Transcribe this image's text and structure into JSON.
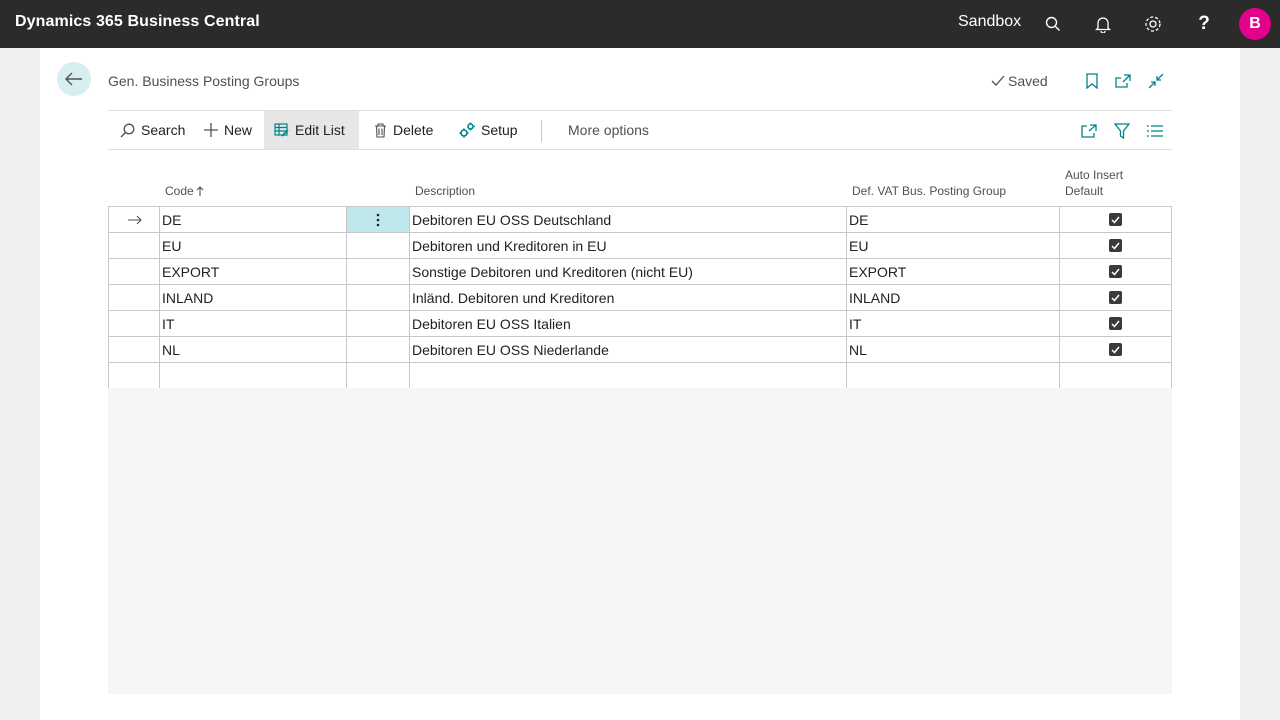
{
  "app": {
    "title": "Dynamics 365 Business Central",
    "environment": "Sandbox",
    "user_initial": "B"
  },
  "page": {
    "title": "Gen. Business Posting Groups",
    "status": "Saved"
  },
  "actions": {
    "search": "Search",
    "new": "New",
    "edit_list": "Edit List",
    "delete": "Delete",
    "setup": "Setup",
    "more_options": "More options"
  },
  "columns": {
    "code": "Code",
    "description": "Description",
    "def_vat": "Def. VAT Bus. Posting Group",
    "auto_insert": "Auto Insert Default"
  },
  "rows": [
    {
      "code": "DE",
      "description": "Debitoren EU OSS Deutschland",
      "def_vat": "DE",
      "auto_insert": true
    },
    {
      "code": "EU",
      "description": "Debitoren und Kreditoren in EU",
      "def_vat": "EU",
      "auto_insert": true
    },
    {
      "code": "EXPORT",
      "description": "Sonstige Debitoren und Kreditoren (nicht EU)",
      "def_vat": "EXPORT",
      "auto_insert": true
    },
    {
      "code": "INLAND",
      "description": "Inländ. Debitoren und Kreditoren",
      "def_vat": "INLAND",
      "auto_insert": true
    },
    {
      "code": "IT",
      "description": "Debitoren EU OSS Italien",
      "def_vat": "IT",
      "auto_insert": true
    },
    {
      "code": "NL",
      "description": "Debitoren EU OSS Niederlande",
      "def_vat": "NL",
      "auto_insert": true
    }
  ],
  "colors": {
    "accent": "#008489",
    "avatar": "#e3008c",
    "appbar": "#2b2b2b",
    "selection": "#bfe8ec"
  }
}
